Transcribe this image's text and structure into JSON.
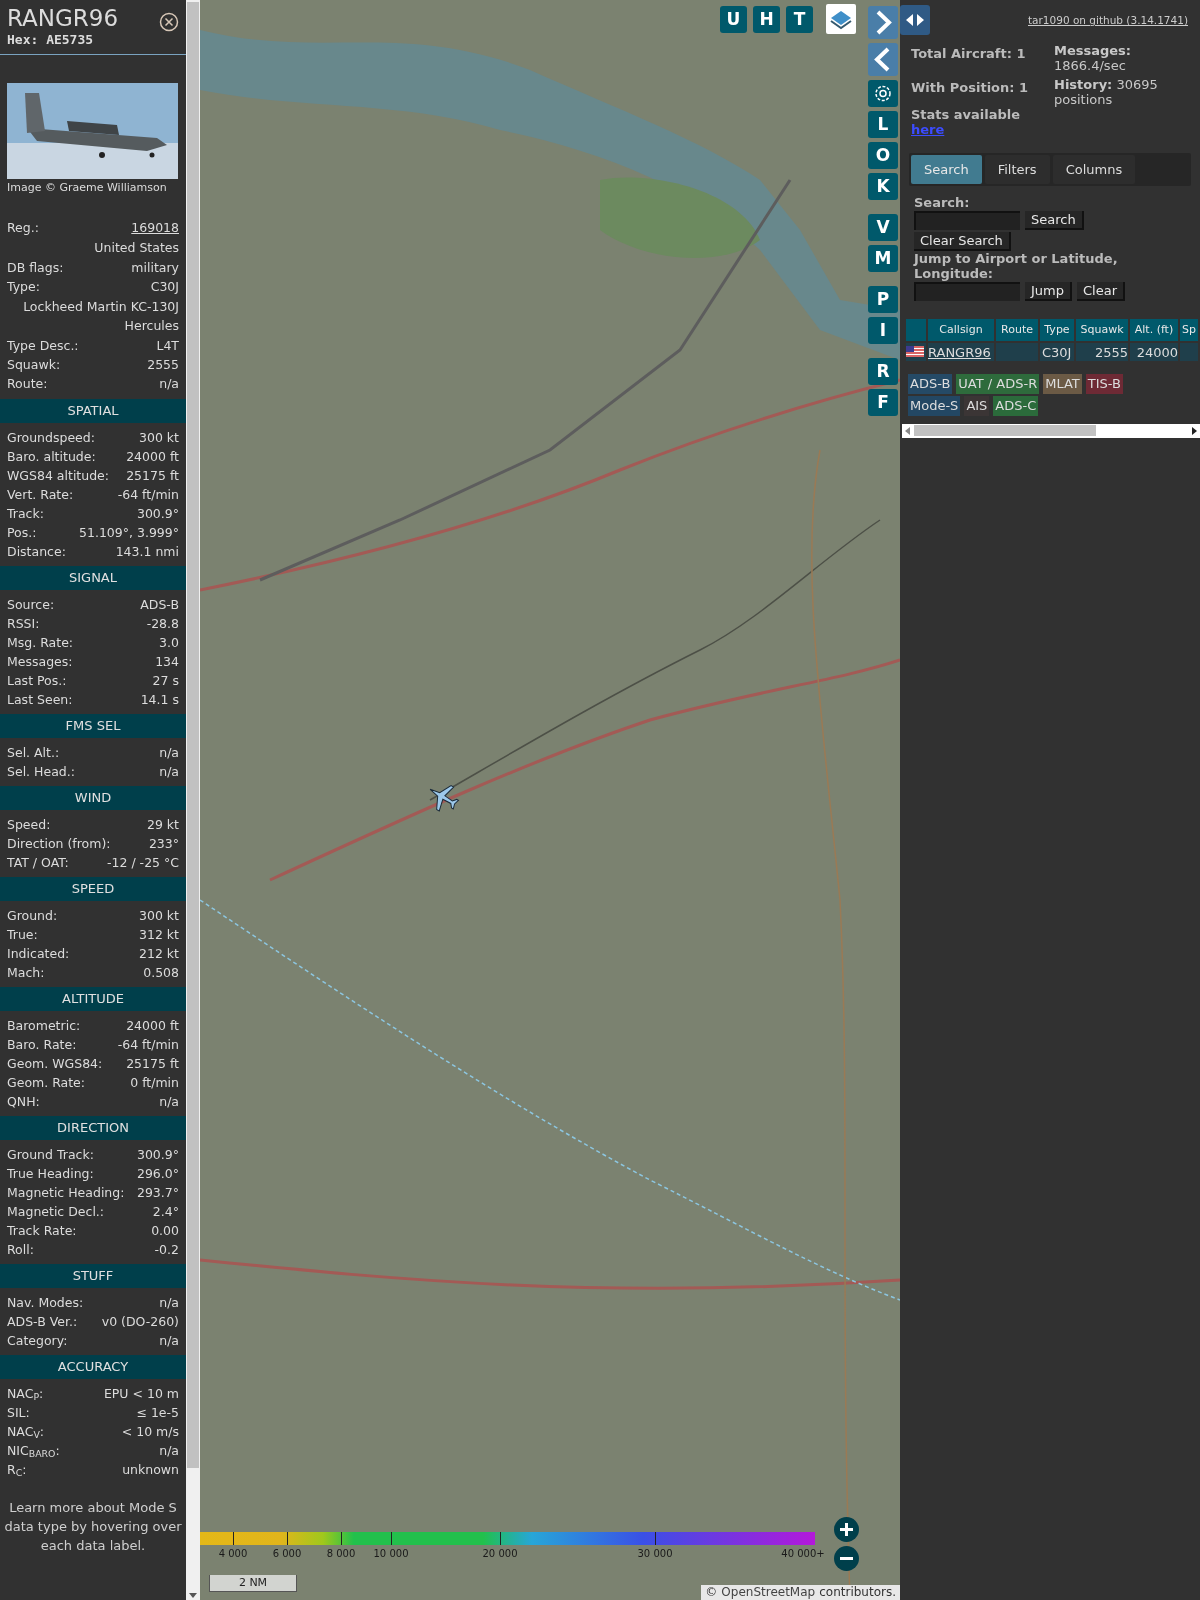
{
  "sidebar": {
    "title": "RANGR96",
    "hex": "Hex: AE5735",
    "photo": {
      "kind": "picture"
    },
    "photo_credit": "Image © Graeme Williamson",
    "rows": [
      {
        "kind": "link",
        "label": "Reg.:",
        "value": "169018"
      },
      {
        "kind": "note",
        "value": "United States"
      },
      {
        "kind": "pair",
        "label": "DB flags:",
        "value": "military"
      },
      {
        "kind": "pair",
        "label": "Type:",
        "value": "C30J"
      },
      {
        "kind": "note",
        "value": "Lockheed Martin KC-130J Hercules"
      },
      {
        "kind": "pair",
        "label": "Type Desc.:",
        "value": "L4T"
      },
      {
        "kind": "pair",
        "label": "Squawk:",
        "value": "2555"
      },
      {
        "kind": "pair",
        "label": "Route:",
        "value": "n/a"
      }
    ],
    "sections": [
      {
        "title": "SPATIAL",
        "rows": [
          {
            "label": "Groundspeed:",
            "value": "300 kt"
          },
          {
            "label": "Baro. altitude:",
            "value": "24000 ft"
          },
          {
            "label": "WGS84 altitude:",
            "value": "25175 ft"
          },
          {
            "label": "Vert. Rate:",
            "value": "-64 ft/min"
          },
          {
            "label": "Track:",
            "value": "300.9°"
          },
          {
            "label": "Pos.:",
            "value": "51.109°, 3.999°"
          },
          {
            "label": "Distance:",
            "value": "143.1 nmi"
          }
        ]
      },
      {
        "title": "SIGNAL",
        "rows": [
          {
            "label": "Source:",
            "value": "ADS-B"
          },
          {
            "label": "RSSI:",
            "value": "-28.8"
          },
          {
            "label": "Msg. Rate:",
            "value": "3.0"
          },
          {
            "label": "Messages:",
            "value": "134"
          },
          {
            "label": "Last Pos.:",
            "value": "27 s"
          },
          {
            "label": "Last Seen:",
            "value": "14.1 s"
          }
        ]
      },
      {
        "title": "FMS SEL",
        "rows": [
          {
            "label": "Sel. Alt.:",
            "value": "n/a"
          },
          {
            "label": "Sel. Head.:",
            "value": "n/a"
          }
        ]
      },
      {
        "title": "WIND",
        "rows": [
          {
            "label": "Speed:",
            "value": "29 kt"
          },
          {
            "label": "Direction (from):",
            "value": "233°"
          },
          {
            "label": "TAT / OAT:",
            "value": "-12 / -25 °C"
          }
        ]
      },
      {
        "title": "SPEED",
        "rows": [
          {
            "label": "Ground:",
            "value": "300 kt"
          },
          {
            "label": "True:",
            "value": "312 kt"
          },
          {
            "label": "Indicated:",
            "value": "212 kt"
          },
          {
            "label": "Mach:",
            "value": "0.508"
          }
        ]
      },
      {
        "title": "ALTITUDE",
        "rows": [
          {
            "label": "Barometric:",
            "value": "24000 ft"
          },
          {
            "label": "Baro. Rate:",
            "value": "-64 ft/min"
          },
          {
            "label": "Geom. WGS84:",
            "value": "25175 ft"
          },
          {
            "label": "Geom. Rate:",
            "value": "0 ft/min"
          },
          {
            "label": "QNH:",
            "value": "n/a"
          }
        ]
      },
      {
        "title": "DIRECTION",
        "rows": [
          {
            "label": "Ground Track:",
            "value": "300.9°"
          },
          {
            "label": "True Heading:",
            "value": "296.0°"
          },
          {
            "label": "Magnetic Heading:",
            "value": "293.7°"
          },
          {
            "label": "Magnetic Decl.:",
            "value": "2.4°"
          },
          {
            "label": "Track Rate:",
            "value": "0.00"
          },
          {
            "label": "Roll:",
            "value": "-0.2"
          }
        ]
      },
      {
        "title": "STUFF",
        "rows": [
          {
            "label": "Nav. Modes:",
            "value": "n/a"
          },
          {
            "label": "ADS-B Ver.:",
            "value": "v0 (DO-260)"
          },
          {
            "label": "Category:",
            "value": "n/a"
          }
        ]
      },
      {
        "title": "ACCURACY",
        "rows": [
          {
            "label": "NAC$_{P}$:",
            "value": "EPU < 10 m"
          },
          {
            "label": "SIL:",
            "value": "≤ 1e-5"
          },
          {
            "label": "NAC$_{V}$:",
            "value": "< 10 m/s"
          },
          {
            "label": "NIC$_{BARO}$:",
            "value": "n/a"
          },
          {
            "label": "R$_{C}$:",
            "value": "unknown"
          }
        ]
      }
    ],
    "note": "Learn more about Mode S data type by hovering over each data label."
  },
  "map": {
    "picture": {
      "kind": "picture"
    },
    "aircraft": {
      "selected": true
    },
    "view_buttons": [
      "U",
      "H",
      "T"
    ],
    "side_buttons": [
      {
        "kind": "next"
      },
      {
        "kind": "prev"
      },
      {
        "kind": "settings"
      },
      {
        "kind": "letter",
        "label": "L"
      },
      {
        "kind": "letter",
        "label": "O"
      },
      {
        "kind": "letter",
        "label": "K"
      },
      {
        "kind": "letter",
        "label": "V"
      },
      {
        "kind": "letter",
        "label": "M"
      },
      {
        "kind": "letter",
        "label": "P"
      },
      {
        "kind": "letter",
        "label": "I"
      },
      {
        "kind": "letter",
        "label": "R"
      },
      {
        "kind": "letter",
        "label": "F"
      }
    ],
    "altitude_legend": [
      "4 000",
      "6 000",
      "8 000",
      "10 000",
      "20 000",
      "30 000",
      "40 000+"
    ],
    "scale": "2 NM",
    "attribution_prefix": "©",
    "attribution_link": "OpenStreetMap",
    "attribution_suffix": "contributors."
  },
  "panel": {
    "version_link": "tar1090 on github (3.14.1741)",
    "stats_left": [
      "Total Aircraft: 1",
      "With Position: 1"
    ],
    "stats_right": [
      "**Messages:** 1866.4/sec",
      "**History:** 30695 positions"
    ],
    "stats_note": "Stats available",
    "stats_link": "here",
    "tabs": [
      {
        "label": "Search",
        "selected": true
      },
      {
        "label": "Filters",
        "selected": false
      },
      {
        "label": "Columns",
        "selected": false
      }
    ],
    "search_label": "Search:",
    "search_button": "Search",
    "clear_search_button": "Clear Search",
    "jump_label": "Jump to Airport or Latitude, Longitude:",
    "jump_button": "Jump",
    "clear_button": "Clear",
    "table": {
      "columns": [
        "Callsign",
        "Route",
        "Type",
        "Squawk",
        "Alt. (ft)",
        "Sp"
      ],
      "rows": [
        {
          "callsign": "RANGR96",
          "type": "C30J",
          "squawk": "2555",
          "altitude": "24000"
        }
      ]
    },
    "sources": [
      {
        "label": "ADS-B",
        "color": "#254a66"
      },
      {
        "label": "UAT / ADS-R",
        "color": "#2e6b3c"
      },
      {
        "label": "MLAT",
        "color": "#6b5a45"
      },
      {
        "label": "TIS-B",
        "color": "#6e2a35"
      },
      {
        "label": "Mode-S",
        "color": "#234763"
      },
      {
        "label": "AIS",
        "color": "#3b3535"
      },
      {
        "label": "ADS-C",
        "color": "#2b6b3b"
      }
    ]
  }
}
